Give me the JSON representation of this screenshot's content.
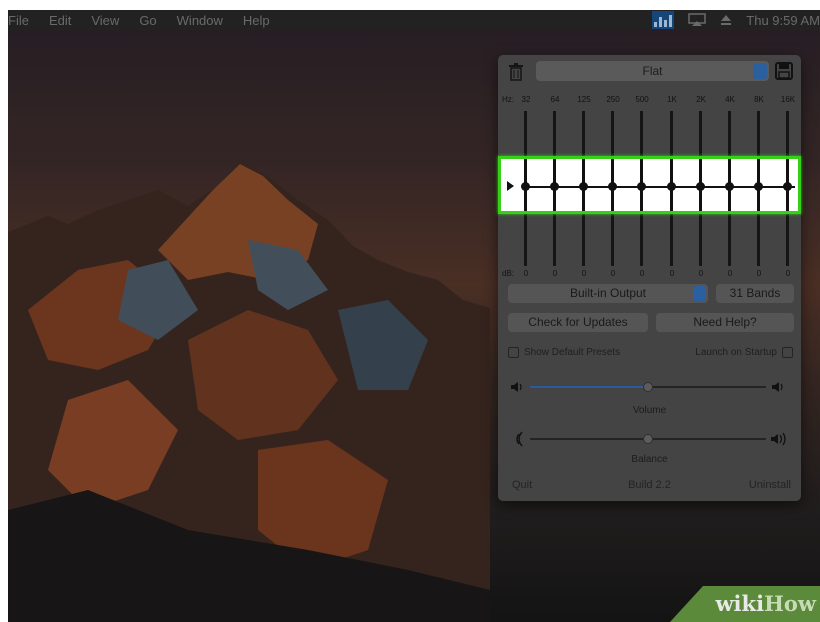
{
  "menubar": {
    "items": [
      "File",
      "Edit",
      "View",
      "Go",
      "Window",
      "Help"
    ],
    "clock": "Thu 9:59 AM",
    "eq_icon": "equalizer-menubar-icon",
    "icons": [
      "airplay-icon",
      "eject-icon"
    ]
  },
  "equalizer": {
    "preset": "Flat",
    "hz_prefix": "Hz:",
    "hz_labels": [
      "32",
      "64",
      "125",
      "250",
      "500",
      "1K",
      "2K",
      "4K",
      "8K",
      "16K"
    ],
    "db_prefix": "dB:",
    "db_values": [
      "0",
      "0",
      "0",
      "0",
      "0",
      "0",
      "0",
      "0",
      "0",
      "0"
    ],
    "band_levels": [
      0,
      0,
      0,
      0,
      0,
      0,
      0,
      0,
      0,
      0
    ],
    "highlight_color": "#35d017",
    "device": "Built-in Output",
    "bands_button": "31 Bands",
    "check_updates": "Check for Updates",
    "need_help": "Need Help?",
    "show_default_presets": "Show Default Presets",
    "launch_on_startup": "Launch on Startup",
    "volume_label": "Volume",
    "volume_level": 0.5,
    "balance_label": "Balance",
    "balance_level": 0.5,
    "quit": "Quit",
    "build": "Build 2.2",
    "uninstall": "Uninstall"
  },
  "watermark": {
    "wiki": "wiki",
    "how": "How"
  }
}
